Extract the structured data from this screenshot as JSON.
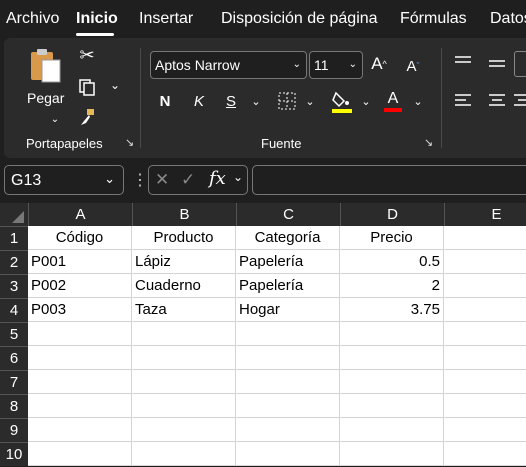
{
  "menu": {
    "items": [
      "Archivo",
      "Inicio",
      "Insertar",
      "Disposición de página",
      "Fórmulas",
      "Datos"
    ],
    "active": "Inicio"
  },
  "ribbon": {
    "clipboard": {
      "label": "Portapapeles",
      "paste_label": "Pegar"
    },
    "font": {
      "label": "Fuente",
      "font_name": "Aptos Narrow",
      "font_size": "11",
      "bold_label": "N",
      "italic_label": "K",
      "underline_label": "S",
      "grow_label": "A",
      "shrink_label": "A",
      "font_color_label": "A",
      "highlight_color": "#ffff00",
      "font_color": "#ff0000"
    }
  },
  "formula_bar": {
    "name_box": "G13",
    "formula": ""
  },
  "sheet": {
    "columns": [
      "A",
      "B",
      "C",
      "D",
      "E"
    ],
    "rows": [
      "1",
      "2",
      "3",
      "4",
      "5",
      "6",
      "7",
      "8",
      "9",
      "10"
    ],
    "header": [
      "Código",
      "Producto",
      "Categoría",
      "Precio"
    ],
    "data": [
      [
        "P001",
        "Lápiz",
        "Papelería",
        "0.5"
      ],
      [
        "P002",
        "Cuaderno",
        "Papelería",
        "2"
      ],
      [
        "P003",
        "Taza",
        "Hogar",
        "3.75"
      ]
    ]
  }
}
